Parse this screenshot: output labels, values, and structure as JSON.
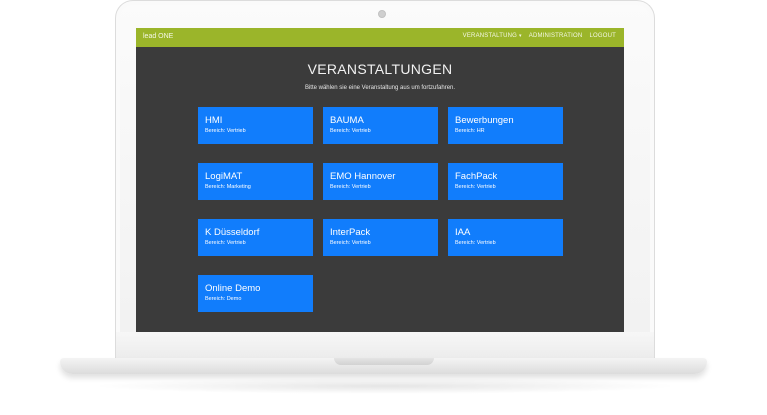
{
  "navbar": {
    "brand": "lead ONE",
    "links": [
      {
        "label": "VERANSTALTUNG",
        "caret": "▾"
      },
      {
        "label": "ADMINISTRATION"
      },
      {
        "label": "LOGOUT"
      }
    ]
  },
  "main": {
    "title": "VERANSTALTUNGEN",
    "subtitle": "Bitte wählen sie eine Veranstaltung aus um fortzufahren.",
    "events": [
      {
        "name": "HMI",
        "area": "Bereich: Vertrieb"
      },
      {
        "name": "BAUMA",
        "area": "Bereich: Vertrieb"
      },
      {
        "name": "Bewerbungen",
        "area": "Bereich: HR"
      },
      {
        "name": "LogiMAT",
        "area": "Bereich: Marketing"
      },
      {
        "name": "EMO Hannover",
        "area": "Bereich: Vertrieb"
      },
      {
        "name": "FachPack",
        "area": "Bereich: Vertrieb"
      },
      {
        "name": "K Düsseldorf",
        "area": "Bereich: Vertrieb"
      },
      {
        "name": "InterPack",
        "area": "Bereich: Vertrieb"
      },
      {
        "name": "IAA",
        "area": "Bereich: Vertrieb"
      },
      {
        "name": "Online Demo",
        "area": "Bereich: Demo"
      }
    ]
  },
  "colors": {
    "navbar": "#9bb52a",
    "background": "#3b3b3b",
    "card": "#117dfc"
  }
}
